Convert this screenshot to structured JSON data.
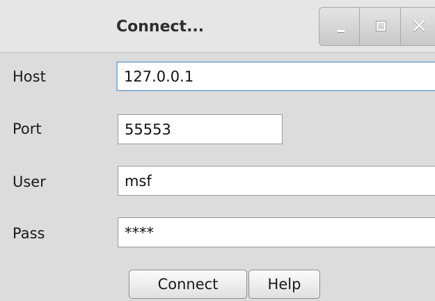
{
  "window": {
    "title": "Connect..."
  },
  "titlebar_buttons": {
    "minimize": "minimize-icon",
    "maximize": "maximize-icon",
    "close": "close-icon"
  },
  "form": {
    "host": {
      "label": "Host",
      "value": "127.0.0.1"
    },
    "port": {
      "label": "Port",
      "value": "55553"
    },
    "user": {
      "label": "User",
      "value": "msf"
    },
    "pass": {
      "label": "Pass",
      "value": "****"
    }
  },
  "buttons": {
    "connect": "Connect",
    "help": "Help"
  }
}
